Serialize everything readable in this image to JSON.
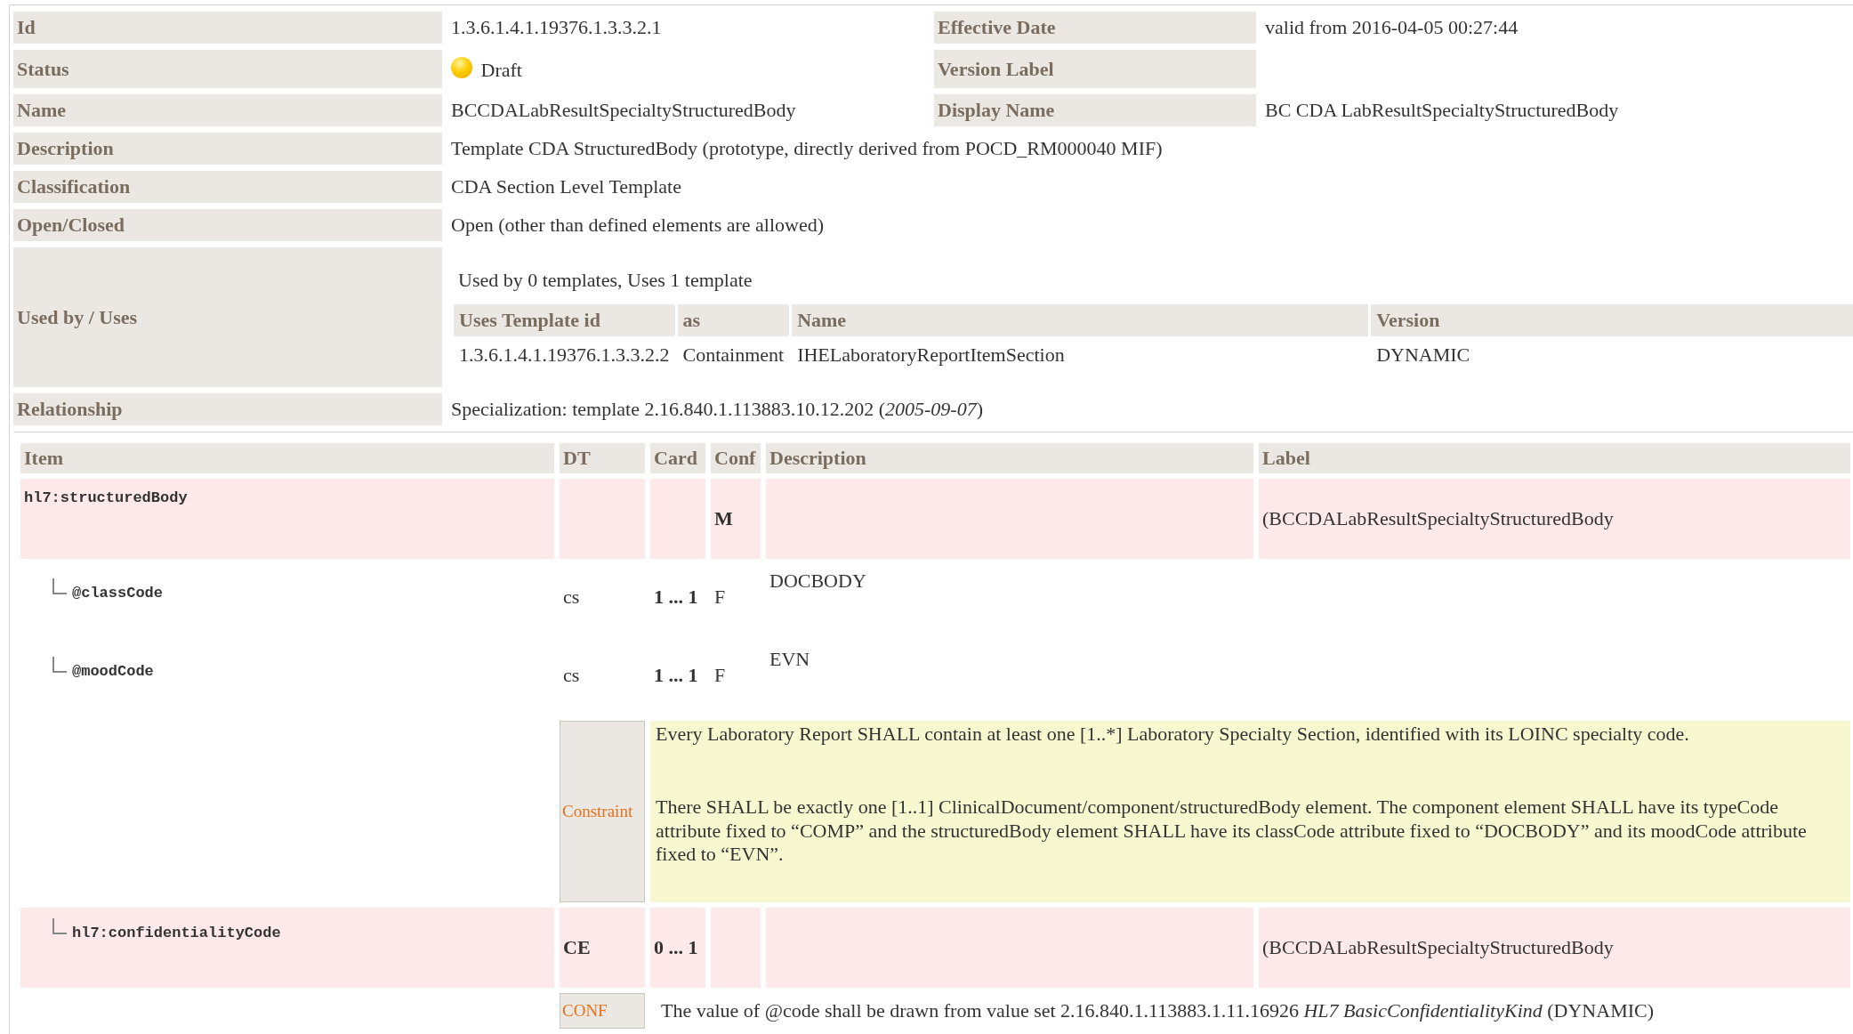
{
  "properties": [
    {
      "cells": [
        {
          "label": "Id",
          "value": "1.3.6.1.4.1.19376.1.3.3.2.1"
        },
        {
          "label": "Effective Date",
          "value": "valid from 2016-04-05 00:27:44"
        }
      ]
    },
    {
      "cells": [
        {
          "label": "Status",
          "kind": "status",
          "value": "Draft"
        },
        {
          "label": "Version Label"
        }
      ]
    },
    {
      "cells": [
        {
          "label": "Name",
          "value": "BCCDALabResultSpecialtyStructuredBody"
        },
        {
          "label": "Display Name",
          "value": "BC CDA LabResultSpecialtyStructuredBody"
        }
      ]
    },
    {
      "cells": [
        {
          "label": "Description",
          "value": "Template CDA StructuredBody (prototype, directly derived from POCD_RM000040 MIF)"
        }
      ]
    },
    {
      "cells": [
        {
          "label": "Classification",
          "value": "CDA Section Level Template"
        }
      ]
    },
    {
      "cells": [
        {
          "label": "Open/Closed",
          "value": "Open (other than defined elements are allowed)"
        }
      ]
    },
    {
      "cells": [
        {
          "label": "Used by / Uses",
          "kind": "usage",
          "summary": "Used by 0 templates, Uses 1 template",
          "table": {
            "columns": [
              "Uses Template id",
              "as",
              "Name",
              "Version"
            ],
            "rows": [
              [
                "1.3.6.1.4.1.19376.1.3.3.2.2",
                "Containment",
                "IHELaboratoryReportItemSection",
                "DYNAMIC"
              ]
            ]
          }
        }
      ]
    },
    {
      "cells": [
        {
          "label": "Relationship",
          "value": "Specialization: template 2.16.840.1.113883.10.12.202 (*2005-09-07*)"
        }
      ]
    }
  ],
  "items": {
    "columns": [
      "Item",
      "DT",
      "Card",
      "Conf",
      "Description",
      "Label"
    ],
    "rows": [
      {
        "kind": "element",
        "name": "hl7:structuredBody",
        "conf": "M",
        "label": "(BCCDALabResultSpecialtyStructuredBody",
        "children": [
          {
            "kind": "attribute",
            "name": "@classCode",
            "dt": "cs",
            "card": "1 ... 1",
            "conf": "F",
            "description": "DOCBODY"
          },
          {
            "kind": "attribute",
            "name": "@moodCode",
            "dt": "cs",
            "card": "1 ... 1",
            "conf": "F",
            "description": "EVN"
          },
          {
            "kind": "constraint",
            "tag": "Constraint",
            "paragraphs": [
              "Every Laboratory Report SHALL contain at least one [1..*] Laboratory Specialty Section, identified with its LOINC specialty code.",
              "There SHALL be exactly one [1..1] ClinicalDocument/component/structuredBody element.  The component element SHALL have its typeCode attribute fixed to “COMP” and the structuredBody element SHALL have its classCode attribute fixed to “DOCBODY” and its moodCode attribute fixed to “EVN”."
            ]
          },
          {
            "kind": "element",
            "name": "hl7:confidentialityCode",
            "dt": "CE",
            "card": "0 ... 1",
            "label": "(BCCDALabResultSpecialtyStructuredBody",
            "children": [
              {
                "kind": "conf",
                "tag": "CONF",
                "text": "The value of @code shall be drawn from value set 2.16.840.1.113883.1.11.16926 *HL7 BasicConfidentialityKind* (DYNAMIC)"
              }
            ]
          }
        ]
      }
    ]
  }
}
